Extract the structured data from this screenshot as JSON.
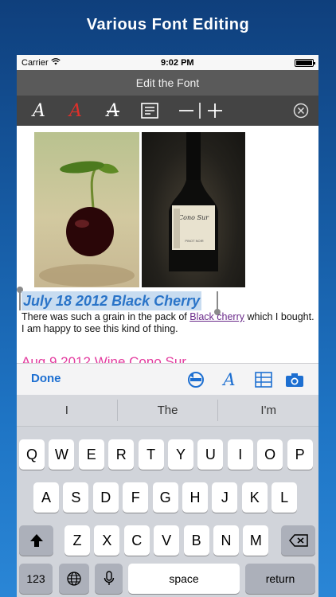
{
  "promo": {
    "title": "Various Font Editing"
  },
  "status": {
    "carrier": "Carrier",
    "time": "9:02 PM"
  },
  "navbar": {
    "title": "Edit the Font"
  },
  "editor": {
    "heading1": "July 18 2012   Black Cherry",
    "body_pre": " There was such a grain in the pack of ",
    "body_link": "Black cherry",
    "body_post": " which I bought. I am happy to see this kind of thing.",
    "heading2": "Aug 9 2012   Wine Cono Sur"
  },
  "accessory": {
    "done_label": "Done"
  },
  "keyboard": {
    "predictions": [
      "I",
      "The",
      "I'm"
    ],
    "row1": [
      "Q",
      "W",
      "E",
      "R",
      "T",
      "Y",
      "U",
      "I",
      "O",
      "P"
    ],
    "row2": [
      "A",
      "S",
      "D",
      "F",
      "G",
      "H",
      "J",
      "K",
      "L"
    ],
    "row3": [
      "Z",
      "X",
      "C",
      "V",
      "B",
      "N",
      "M"
    ],
    "numbers_label": "123",
    "space_label": "space",
    "return_label": "return"
  },
  "colors": {
    "accent_blue": "#1d6fd1",
    "selected_heading": "#2a74c8",
    "heading_pink": "#e33a9e",
    "link_purple": "#6a2a8a"
  },
  "icons": [
    "wifi-icon",
    "battery-icon",
    "font-style-icon",
    "font-color-icon",
    "font-strike-icon",
    "align-icon",
    "minus-icon",
    "plus-icon",
    "close-icon",
    "undo-icon",
    "font-icon",
    "table-icon",
    "camera-icon",
    "shift-icon",
    "backspace-icon",
    "globe-icon",
    "microphone-icon"
  ]
}
